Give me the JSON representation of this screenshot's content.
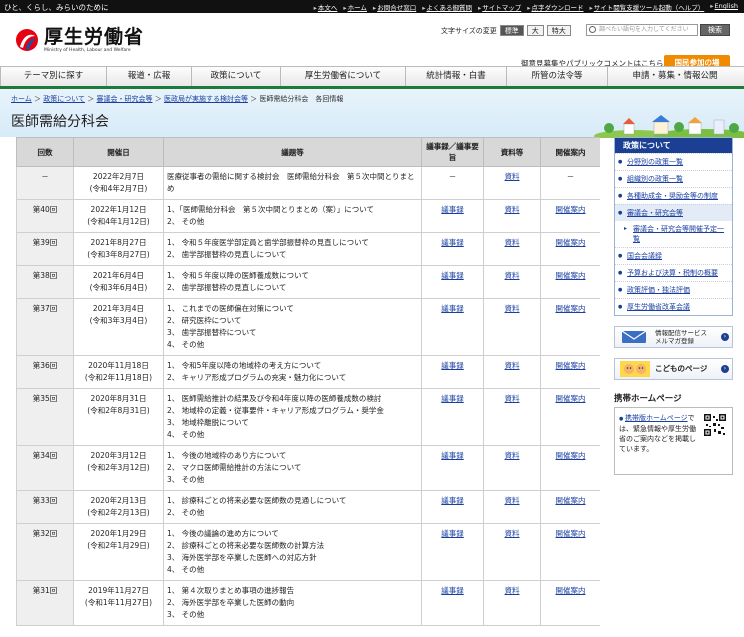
{
  "topbar": {
    "slogan": "ひと、くらし、みらいのために",
    "links": [
      "本文へ",
      "ホーム",
      "お問合せ窓口",
      "よくある御質問",
      "サイトマップ",
      "点字ダウンロード",
      "サイト閲覧支援ツール起動（ヘルプ）",
      "English"
    ]
  },
  "header": {
    "logo_jp": "厚生労働省",
    "logo_en": "Ministry of Health, Labour and Welfare",
    "fontsize_label": "文字サイズの変更",
    "fontsize_options": [
      "標準",
      "大",
      "特大"
    ],
    "search_placeholder": "調べたい語句を入力してください",
    "search_button": "検索",
    "opinion_link": "御意見募集やパブリックコメントはこちら",
    "kokumin_button": "国民参加の場"
  },
  "nav": {
    "items": [
      "テーマ別に探す",
      "報道・広報",
      "政策について",
      "厚生労働省について",
      "統計情報・白書",
      "所管の法令等",
      "申請・募集・情報公開"
    ]
  },
  "breadcrumb": {
    "items": [
      "ホーム",
      "政策について",
      "審議会・研究会等",
      "医政局が実施する検討会等"
    ],
    "current": "医師需給分科会　各回情報"
  },
  "page_title": "医師需給分科会",
  "table": {
    "headers": [
      "回数",
      "開催日",
      "議題等",
      "議事録／議事要旨",
      "資料等",
      "開催案内"
    ],
    "rows": [
      {
        "no": "－",
        "date1": "2022年2月7日",
        "date2": "(令和4年2月7日)",
        "agenda": [
          "医療従事者の需給に関する検討会　医師需給分科会　第５次中間とりまとめ"
        ],
        "minutes": "－",
        "docs": "資料",
        "notice": "－"
      },
      {
        "no": "第40回",
        "date1": "2022年1月12日",
        "date2": "(令和4年1月12日)",
        "agenda": [
          "1、「医師需給分科会　第５次中間とりまとめ（案）」について",
          "2、 その他"
        ],
        "minutes": "議事録",
        "docs": "資料",
        "notice": "開催案内"
      },
      {
        "no": "第39回",
        "date1": "2021年8月27日",
        "date2": "(令和3年8月27日)",
        "agenda": [
          "1、 令和５年度医学部定員と歯学部振替枠の見直しについて",
          "2、 歯学部振替枠の見直しについて"
        ],
        "minutes": "議事録",
        "docs": "資料",
        "notice": "開催案内"
      },
      {
        "no": "第38回",
        "date1": "2021年6月4日",
        "date2": "(令和3年6月4日)",
        "agenda": [
          "1、 令和５年度以降の医師養成数について",
          "2、 歯学部振替枠の見直しについて"
        ],
        "minutes": "議事録",
        "docs": "資料",
        "notice": "開催案内"
      },
      {
        "no": "第37回",
        "date1": "2021年3月4日",
        "date2": "(令和3年3月4日)",
        "agenda": [
          "1、 これまでの医師偏在対策について",
          "2、 研究医枠について",
          "3、 歯学部振替枠について",
          "4、 その他"
        ],
        "minutes": "議事録",
        "docs": "資料",
        "notice": "開催案内"
      },
      {
        "no": "第36回",
        "date1": "2020年11月18日",
        "date2": "(令和2年11月18日)",
        "agenda": [
          "1、 令和5年度以降の地域枠の考え方について",
          "2、 キャリア形成プログラムの充実・魅力化について"
        ],
        "minutes": "議事録",
        "docs": "資料",
        "notice": "開催案内"
      },
      {
        "no": "第35回",
        "date1": "2020年8月31日",
        "date2": "(令和2年8月31日)",
        "agenda": [
          "1、 医師需給推計の結果及び令和4年度以降の医師養成数の検討",
          "2、 地域枠の定義・従事要件・キャリア形成プログラム・奨学金",
          "3、 地域枠離脱について",
          "4、 その他"
        ],
        "minutes": "議事録",
        "docs": "資料",
        "notice": "開催案内"
      },
      {
        "no": "第34回",
        "date1": "2020年3月12日",
        "date2": "(令和2年3月12日)",
        "agenda": [
          "1、 今後の地域枠のあり方について",
          "2、 マクロ医師需給推計の方法について",
          "3、 その他"
        ],
        "minutes": "議事録",
        "docs": "資料",
        "notice": "開催案内"
      },
      {
        "no": "第33回",
        "date1": "2020年2月13日",
        "date2": "(令和2年2月13日)",
        "agenda": [
          "1、 診療科ごとの将来必要な医師数の見通しについて",
          "2、 その他"
        ],
        "minutes": "議事録",
        "docs": "資料",
        "notice": "開催案内"
      },
      {
        "no": "第32回",
        "date1": "2020年1月29日",
        "date2": "(令和2年1月29日)",
        "agenda": [
          "1、 今後の議論の進め方について",
          "2、 診療科ごとの将来必要な医師数の計算方法",
          "3、 海外医学部を卒業した医師への対応方針",
          "4、 その他"
        ],
        "minutes": "議事録",
        "docs": "資料",
        "notice": "開催案内"
      },
      {
        "no": "第31回",
        "date1": "2019年11月27日",
        "date2": "(令和1年11月27日)",
        "agenda": [
          "1、 第４次取りまとめ事項の進捗報告",
          "2、 海外医学部を卒業した医師の動向",
          "3、 その他"
        ],
        "minutes": "議事録",
        "docs": "資料",
        "notice": "開催案内"
      }
    ]
  },
  "sidebar": {
    "heading": "政策について",
    "items": [
      "分野別の政策一覧",
      "組織別の政策一覧",
      "各種助成金・奨励金等の制度",
      "審議会・研究会等"
    ],
    "sub_item": "審議会・研究会等開催予定一覧",
    "items2": [
      "国会会議録",
      "予算および決算・税制の概要",
      "政策評価・独法評価",
      "厚生労働省改革会議"
    ],
    "banner1": [
      "情報配信サービス",
      "メルマガ登録"
    ],
    "banner2": "こどものページ",
    "mobile_title": "携帯ホームページ",
    "mobile_link": "携帯版ホームページ",
    "mobile_text": "では、緊急情報や厚生労働省のご案内などを掲載しています。",
    "accent": "#1a3f93"
  }
}
